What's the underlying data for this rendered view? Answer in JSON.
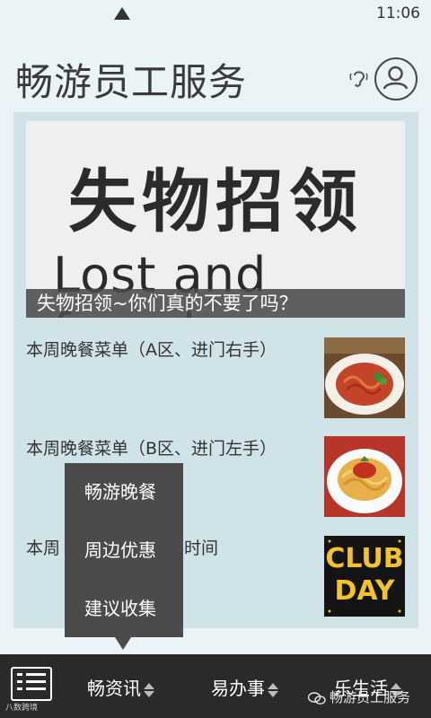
{
  "status": {
    "time": "11:06"
  },
  "header": {
    "title": "畅游员工服务"
  },
  "banner": {
    "title_cn": "失物招领",
    "title_en": "Lost and found",
    "caption": "失物招领~你们真的不要了吗？"
  },
  "list": [
    {
      "title": "本周晚餐菜单（A区、进门右手）",
      "thumb": "pasta-icon"
    },
    {
      "title": "本周晚餐菜单（B区、进门左手）",
      "thumb": "spaghetti-icon"
    },
    {
      "title": "本周",
      "title_tail": "时间",
      "thumb": "club-day-icon",
      "thumb_text": "CLUB DAY"
    }
  ],
  "popup_menu": {
    "items": [
      "畅游晚餐",
      "周边优惠",
      "建议收集"
    ]
  },
  "bottom_nav": {
    "items": [
      "畅资讯",
      "易办事",
      "乐生活"
    ]
  },
  "watermark": {
    "text": "畅游员工服务",
    "corner": "八数跨境"
  },
  "colors": {
    "background": "#eaf3f5",
    "panel": "#cfe3e8",
    "nav_bar": "#2a2a2a",
    "popup": "#4b4b4b",
    "caption_bar": "#4b4b4b"
  }
}
